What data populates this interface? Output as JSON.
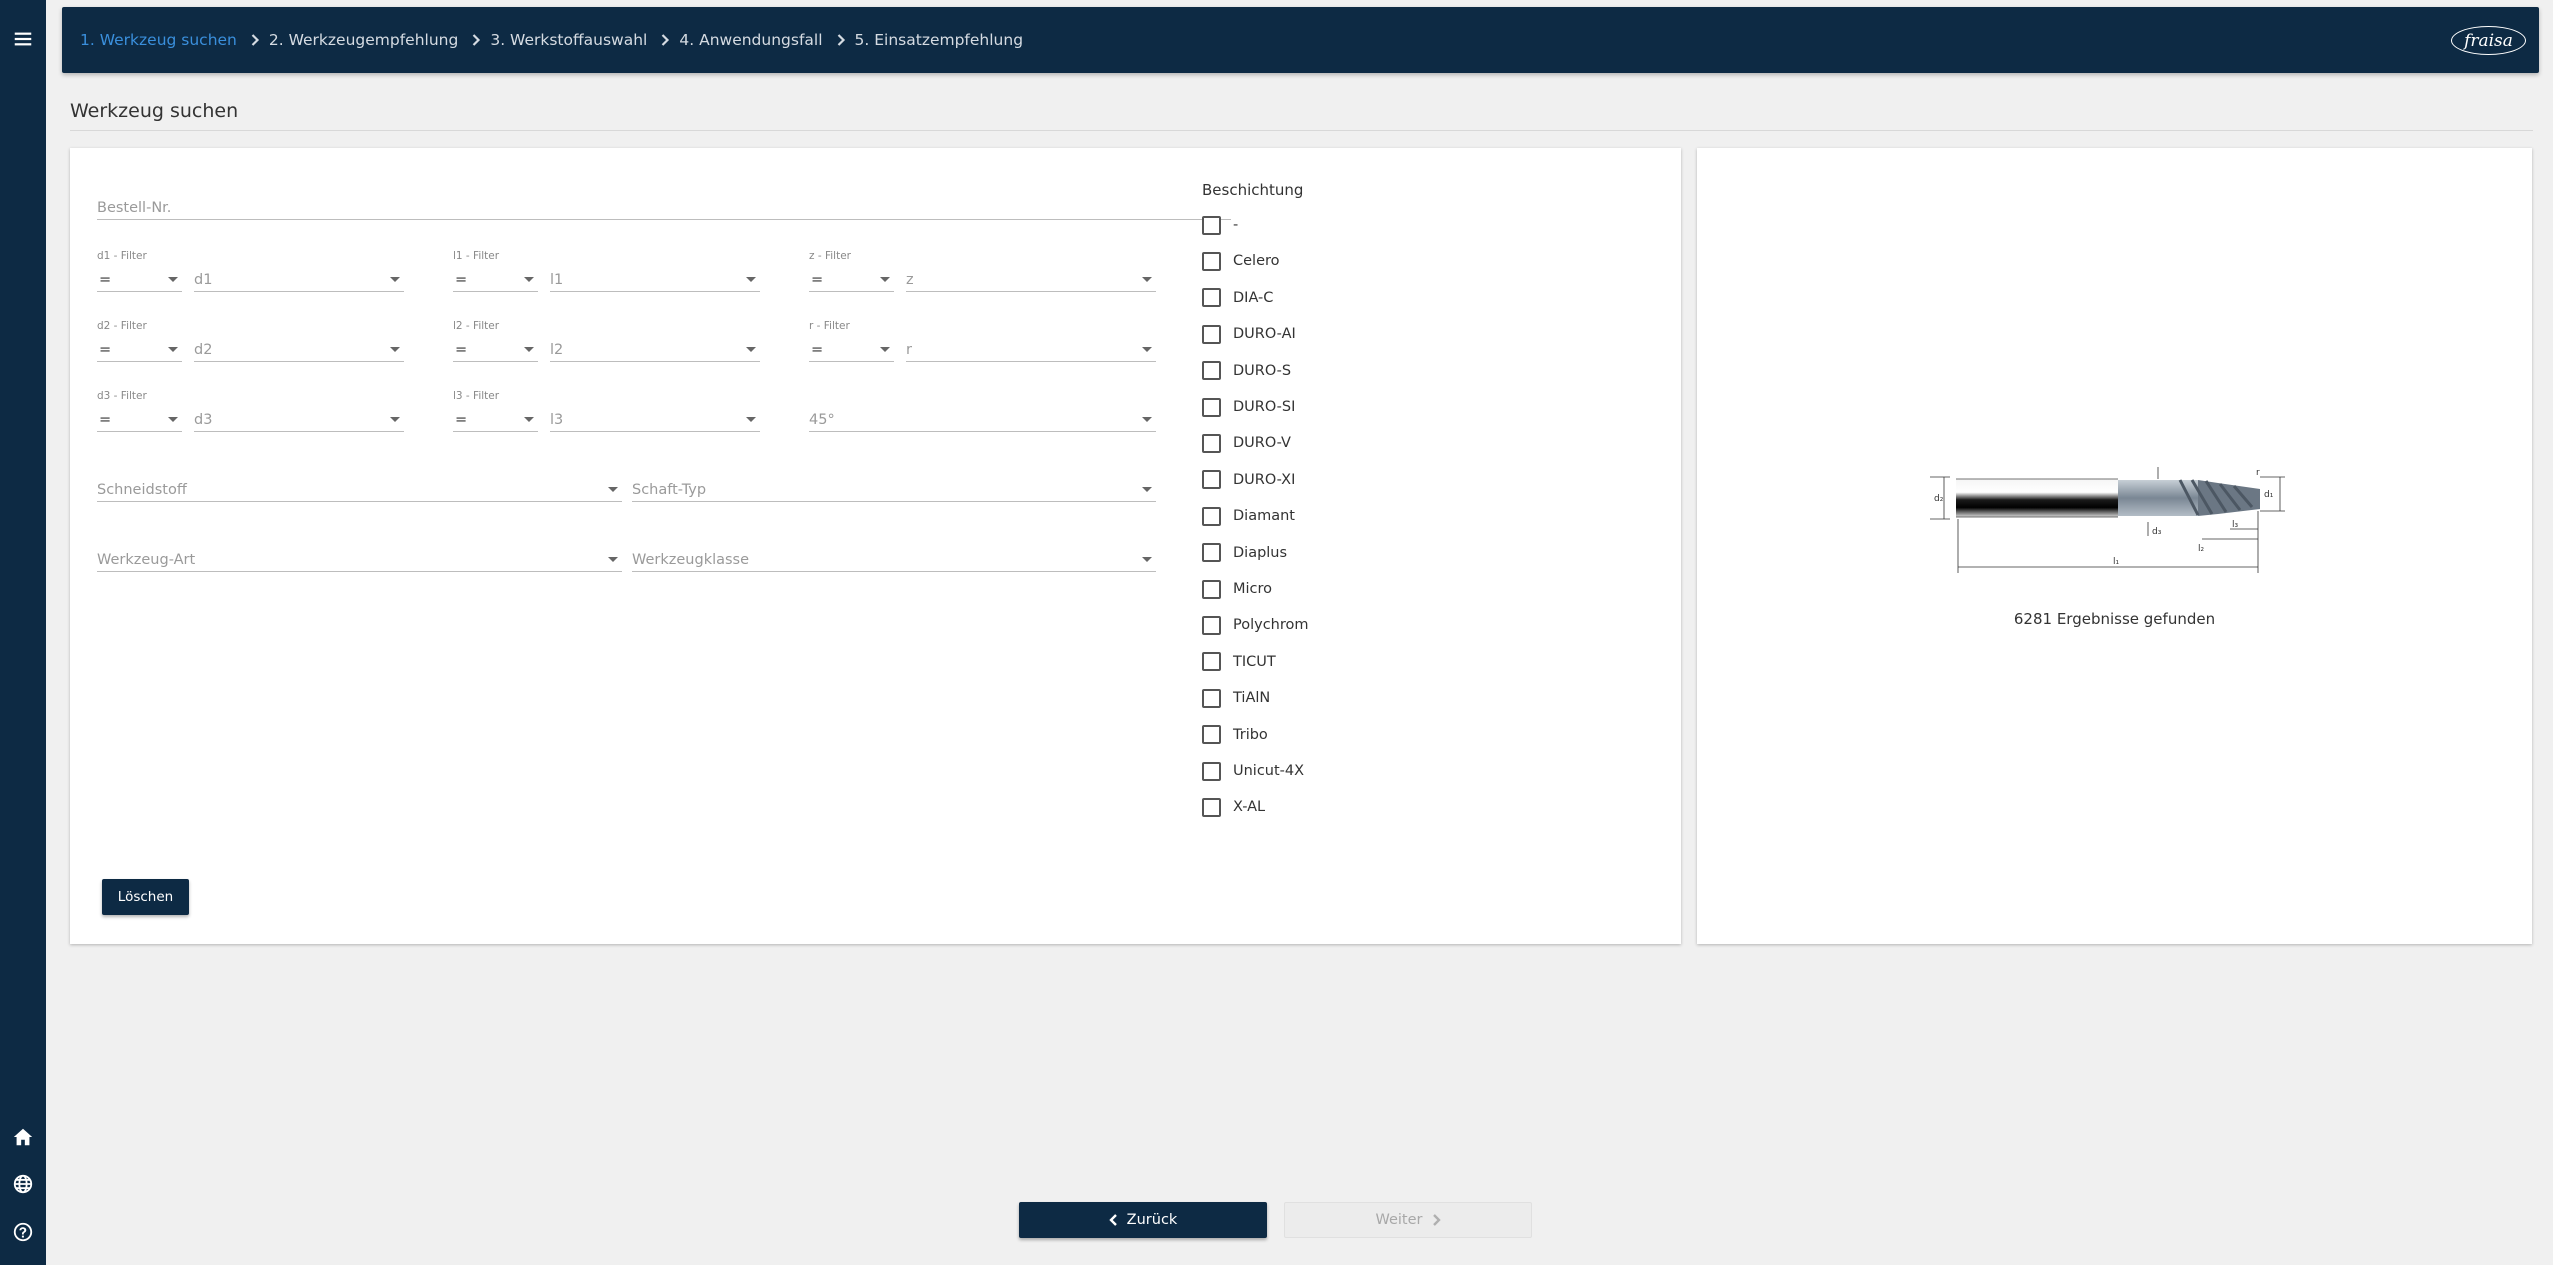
{
  "header": {
    "breadcrumbs": [
      {
        "label": "1. Werkzeug suchen",
        "active": true
      },
      {
        "label": "2. Werkzeugempfehlung",
        "active": false
      },
      {
        "label": "3. Werkstoffauswahl",
        "active": false
      },
      {
        "label": "4. Anwendungsfall",
        "active": false
      },
      {
        "label": "5. Einsatzempfehlung",
        "active": false
      }
    ],
    "logo_text": "fraisa"
  },
  "sidebar": {
    "top_icon": "menu-icon",
    "bottom_icons": [
      "home-icon",
      "globe-icon",
      "help-icon"
    ]
  },
  "page": {
    "title": "Werkzeug suchen"
  },
  "form": {
    "order_number": {
      "placeholder": "Bestell-Nr."
    },
    "filters": {
      "d1": {
        "label": "d1 - Filter",
        "op": "=",
        "placeholder": "d1"
      },
      "l1": {
        "label": "l1 - Filter",
        "op": "=",
        "placeholder": "l1"
      },
      "z": {
        "label": "z - Filter",
        "op": "=",
        "placeholder": "z"
      },
      "d2": {
        "label": "d2 - Filter",
        "op": "=",
        "placeholder": "d2"
      },
      "l2": {
        "label": "l2 - Filter",
        "op": "=",
        "placeholder": "l2"
      },
      "r": {
        "label": "r - Filter",
        "op": "=",
        "placeholder": "r"
      },
      "d3": {
        "label": "d3 - Filter",
        "op": "=",
        "placeholder": "d3"
      },
      "l3": {
        "label": "l3 - Filter",
        "op": "=",
        "placeholder": "l3"
      },
      "angle": {
        "placeholder": "45°"
      }
    },
    "cutting_material": {
      "placeholder": "Schneidstoff"
    },
    "shank_type": {
      "placeholder": "Schaft-Typ"
    },
    "tool_type": {
      "placeholder": "Werkzeug-Art"
    },
    "tool_class": {
      "placeholder": "Werkzeugklasse"
    },
    "clear_label": "Löschen"
  },
  "coating": {
    "title": "Beschichtung",
    "options": [
      "-",
      "Celero",
      "DIA-C",
      "DURO-AI",
      "DURO-S",
      "DURO-SI",
      "DURO-V",
      "DURO-XI",
      "Diamant",
      "Diaplus",
      "Micro",
      "Polychrom",
      "TICUT",
      "TiAlN",
      "Tribo",
      "Unicut-4X",
      "X-AL"
    ]
  },
  "result": {
    "text": "6281 Ergebnisse gefunden",
    "drawing_labels": {
      "d2": "d₂",
      "d1": "d₁",
      "d3": "d₃",
      "l1": "l₁",
      "l2": "l₂",
      "l3": "l₃",
      "r": "r"
    }
  },
  "nav": {
    "back_label": "Zurück",
    "next_label": "Weiter"
  }
}
